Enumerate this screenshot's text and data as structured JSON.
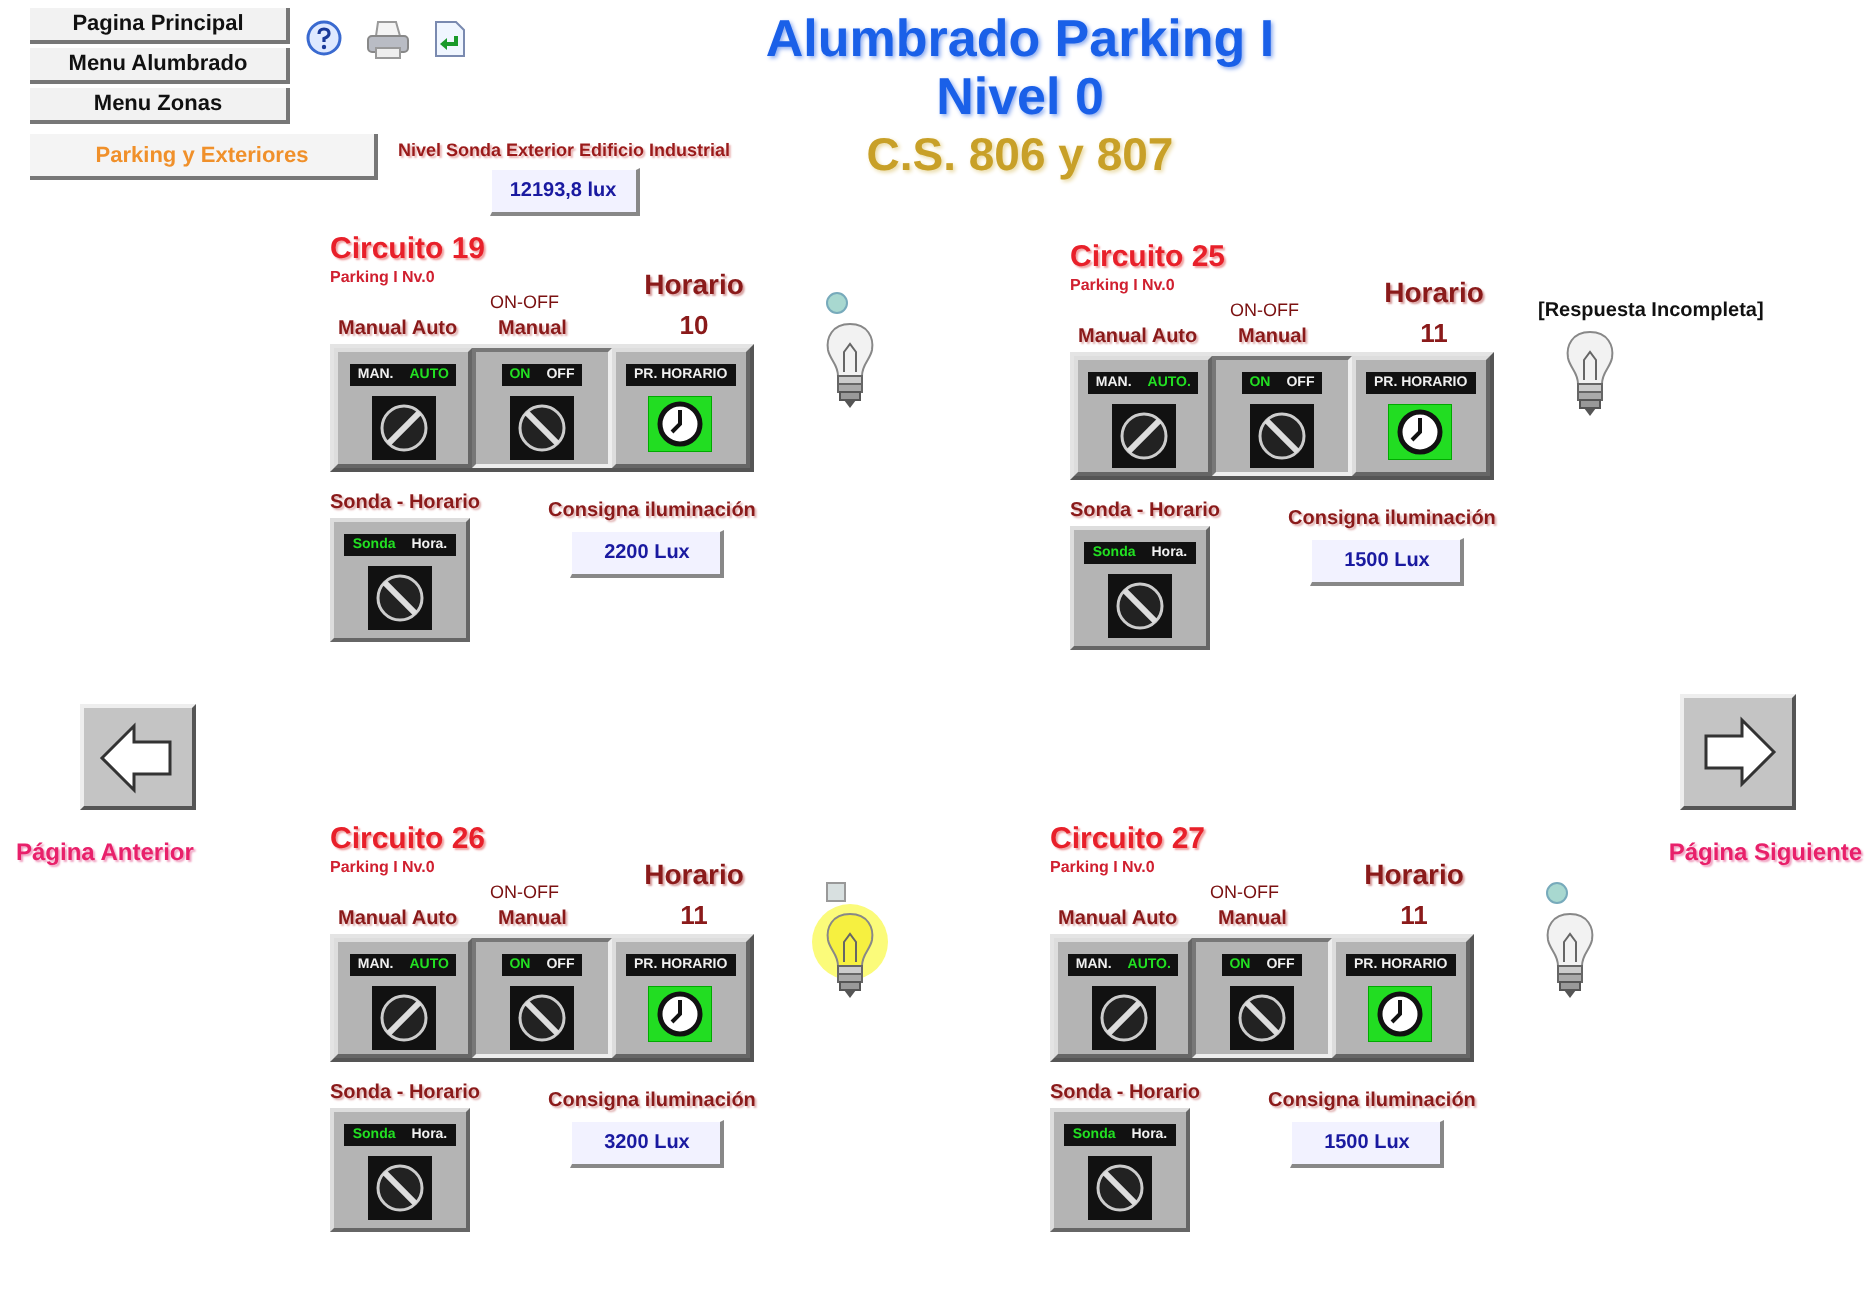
{
  "nav": [
    {
      "label": "Pagina Principal",
      "selected": false
    },
    {
      "label": "Menu Alumbrado",
      "selected": false
    },
    {
      "label": "Menu Zonas",
      "selected": false
    },
    {
      "label": "Parking y Exteriores",
      "selected": true
    }
  ],
  "title": [
    "Alumbrado Parking I",
    "Nivel 0",
    "C.S. 806 y 807"
  ],
  "sensor": {
    "label": "Nivel Sonda Exterior Edificio Industrial",
    "value": "12193,8 lux"
  },
  "circuits": [
    {
      "title": "Circuito 19",
      "subtitle": "Parking I Nv.0",
      "mode": {
        "label": "Manual Auto",
        "options": [
          {
            "label": "MAN.",
            "selected": false
          },
          {
            "label": "AUTO",
            "selected": true
          }
        ]
      },
      "onoff": {
        "label_top": "ON-OFF",
        "label": "Manual",
        "options": [
          {
            "label": "ON",
            "selected": true
          },
          {
            "label": "OFF",
            "selected": false
          }
        ]
      },
      "schedule": {
        "label": "Horario",
        "number": "10",
        "button": "PR. HORARIO",
        "on": true
      },
      "probe": {
        "label": "Sonda - Horario",
        "options": [
          {
            "label": "Sonda",
            "selected": true
          },
          {
            "label": "Hora.",
            "selected": false
          }
        ]
      },
      "setpoint": {
        "label": "Consigna iluminación",
        "value": "2200 Lux"
      },
      "status_light": {
        "kind": "dot"
      },
      "lamp_on": false
    },
    {
      "title": "Circuito 25",
      "subtitle": "Parking I Nv.0",
      "mode": {
        "label": "Manual Auto",
        "options": [
          {
            "label": "MAN.",
            "selected": false
          },
          {
            "label": "AUTO.",
            "selected": true
          }
        ]
      },
      "onoff": {
        "label_top": "ON-OFF",
        "label": "Manual",
        "options": [
          {
            "label": "ON",
            "selected": true
          },
          {
            "label": "OFF",
            "selected": false
          }
        ]
      },
      "schedule": {
        "label": "Horario",
        "number": "11",
        "button": "PR. HORARIO",
        "on": true
      },
      "probe": {
        "label": "Sonda - Horario",
        "options": [
          {
            "label": "Sonda",
            "selected": true
          },
          {
            "label": "Hora.",
            "selected": false
          }
        ]
      },
      "setpoint": {
        "label": "Consigna iluminación",
        "value": "1500 Lux"
      },
      "message": "[Respuesta Incompleta]",
      "lamp_on": false
    },
    {
      "title": "Circuito 26",
      "subtitle": "Parking I Nv.0",
      "mode": {
        "label": "Manual Auto",
        "options": [
          {
            "label": "MAN.",
            "selected": false
          },
          {
            "label": "AUTO",
            "selected": true
          }
        ]
      },
      "onoff": {
        "label_top": "ON-OFF",
        "label": "Manual",
        "options": [
          {
            "label": "ON",
            "selected": true
          },
          {
            "label": "OFF",
            "selected": false
          }
        ]
      },
      "schedule": {
        "label": "Horario",
        "number": "11",
        "button": "PR. HORARIO",
        "on": true
      },
      "probe": {
        "label": "Sonda - Horario",
        "options": [
          {
            "label": "Sonda",
            "selected": true
          },
          {
            "label": "Hora.",
            "selected": false
          }
        ]
      },
      "setpoint": {
        "label": "Consigna iluminación",
        "value": "3200 Lux"
      },
      "status_light": {
        "kind": "square"
      },
      "lamp_on": true
    },
    {
      "title": "Circuito 27",
      "subtitle": "Parking I Nv.0",
      "mode": {
        "label": "Manual Auto",
        "options": [
          {
            "label": "MAN.",
            "selected": false
          },
          {
            "label": "AUTO.",
            "selected": true
          }
        ]
      },
      "onoff": {
        "label_top": "ON-OFF",
        "label": "Manual",
        "options": [
          {
            "label": "ON",
            "selected": true
          },
          {
            "label": "OFF",
            "selected": false
          }
        ]
      },
      "schedule": {
        "label": "Horario",
        "number": "11",
        "button": "PR. HORARIO",
        "on": true
      },
      "probe": {
        "label": "Sonda - Horario",
        "options": [
          {
            "label": "Sonda",
            "selected": true
          },
          {
            "label": "Hora.",
            "selected": false
          }
        ]
      },
      "setpoint": {
        "label": "Consigna iluminación",
        "value": "1500 Lux"
      },
      "status_light": {
        "kind": "dot"
      },
      "lamp_on": false
    }
  ],
  "prev": {
    "label": "Página Anterior"
  },
  "next": {
    "label": "Página Siguiente"
  }
}
